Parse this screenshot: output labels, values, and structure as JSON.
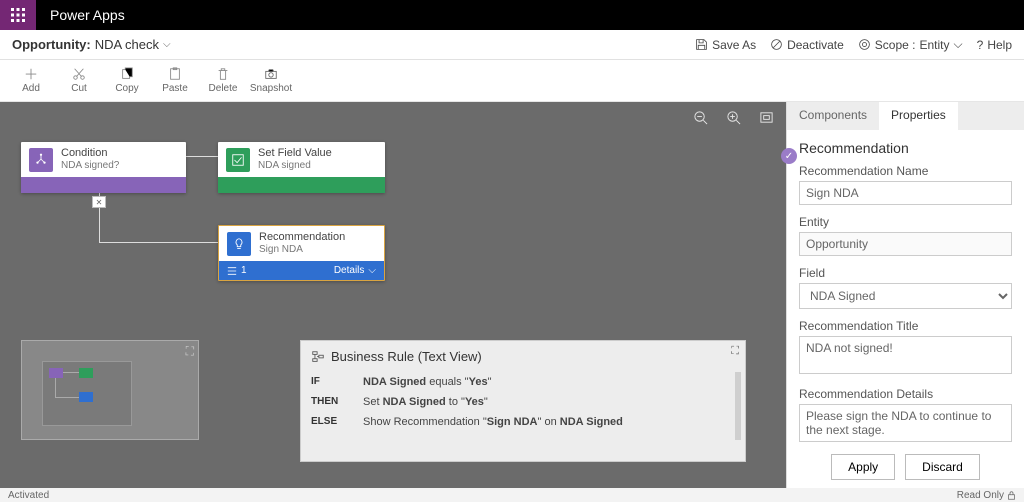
{
  "app_name": "Power Apps",
  "breadcrumb": {
    "entity": "Opportunity:",
    "rule": "NDA check"
  },
  "header_actions": {
    "save_as": "Save As",
    "deactivate": "Deactivate",
    "scope_label": "Scope :",
    "scope_value": "Entity",
    "help": "Help"
  },
  "toolbar": {
    "add": "Add",
    "cut": "Cut",
    "copy": "Copy",
    "paste": "Paste",
    "delete": "Delete",
    "snapshot": "Snapshot"
  },
  "nodes": {
    "condition": {
      "type": "Condition",
      "sub": "NDA signed?"
    },
    "set_field": {
      "type": "Set Field Value",
      "sub": "NDA signed"
    },
    "recommendation": {
      "type": "Recommendation",
      "sub": "Sign NDA",
      "count": "1",
      "details": "Details"
    }
  },
  "text_view": {
    "title": "Business Rule (Text View)",
    "rows": [
      {
        "kw": "IF",
        "html": "<b>NDA Signed</b> equals \"<b>Yes</b>\""
      },
      {
        "kw": "THEN",
        "html": "Set <b>NDA Signed</b> to \"<b>Yes</b>\""
      },
      {
        "kw": "ELSE",
        "html": "Show Recommendation \"<b>Sign NDA</b>\" on <b>NDA Signed</b>"
      }
    ]
  },
  "tabs": {
    "components": "Components",
    "properties": "Properties"
  },
  "properties": {
    "heading": "Recommendation",
    "name_label": "Recommendation Name",
    "name_value": "Sign NDA",
    "entity_label": "Entity",
    "entity_value": "Opportunity",
    "field_label": "Field",
    "field_value": "NDA Signed",
    "title_label": "Recommendation Title",
    "title_value": "NDA not signed!",
    "details_label": "Recommendation Details",
    "details_value": "Please sign the NDA to continue to the next stage.",
    "apply": "Apply",
    "discard": "Discard"
  },
  "footer": {
    "status": "Activated",
    "read_only": "Read Only"
  }
}
